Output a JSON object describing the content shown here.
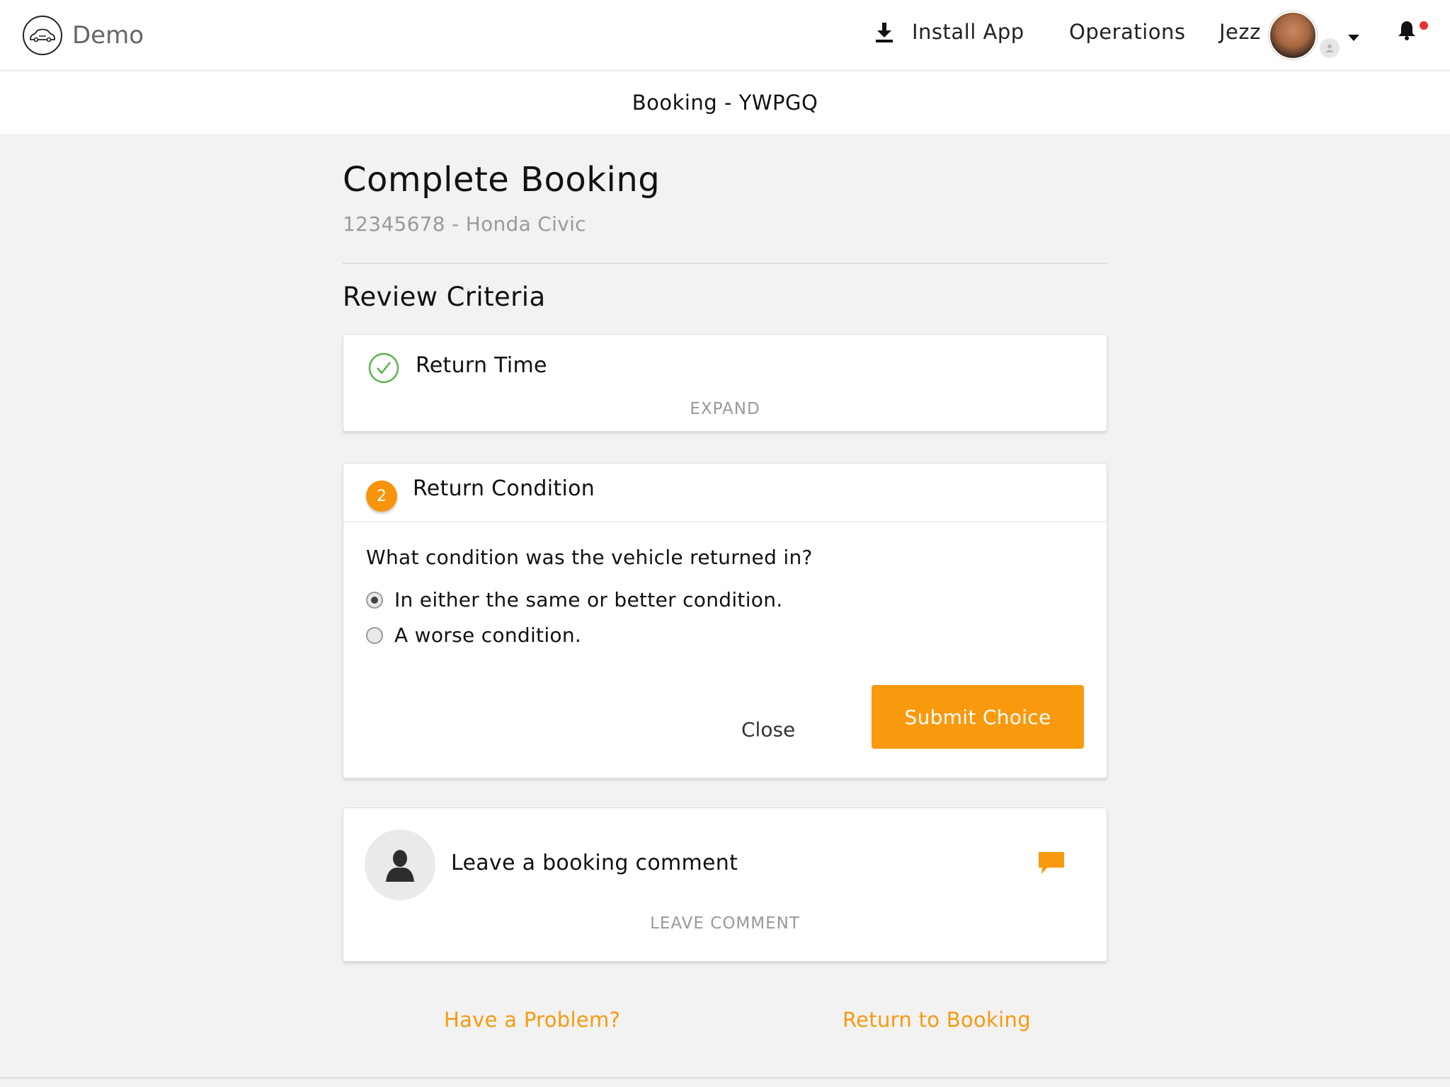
{
  "nav": {
    "brand": "Demo",
    "install_app": "Install App",
    "operations": "Operations",
    "user_name": "Jezz",
    "notification_dot_color": "#e8312f"
  },
  "subheader": {
    "title": "Booking - YWPGQ"
  },
  "page": {
    "title": "Complete Booking",
    "subtitle": "12345678 - Honda Civic",
    "section_title": "Review Criteria"
  },
  "criteria": [
    {
      "status": "complete",
      "icon": "check-circle-icon",
      "title": "Return Time",
      "action": "EXPAND"
    },
    {
      "status": "active",
      "step": "2",
      "title": "Return Condition",
      "question": "What condition was the vehicle returned in?",
      "options": [
        {
          "label": "In either the same or better condition.",
          "selected": true
        },
        {
          "label": "A worse condition.",
          "selected": false
        }
      ],
      "close_label": "Close",
      "submit_label": "Submit Choice"
    }
  ],
  "comment": {
    "heading": "Leave a booking comment",
    "action": "LEAVE COMMENT"
  },
  "footer": {
    "problem_link": "Have a Problem?",
    "return_link": "Return to Booking"
  },
  "colors": {
    "accent": "#f9990d",
    "success": "#5cb24a",
    "muted_text": "#999999"
  }
}
